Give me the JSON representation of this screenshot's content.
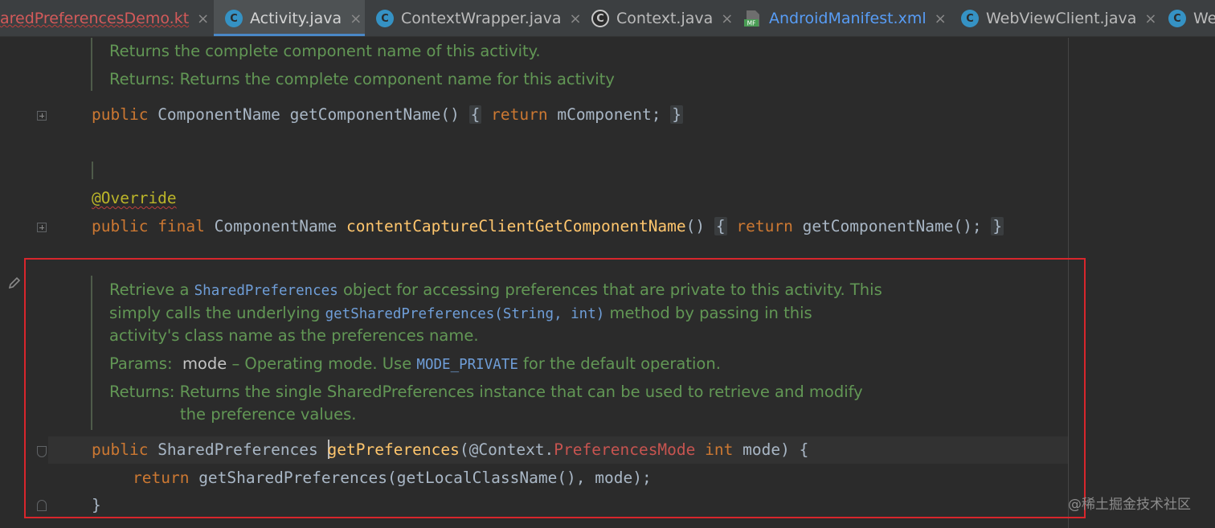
{
  "tabs": [
    {
      "label": "aredPreferencesDemo.kt",
      "icon": "kotlin-file-icon",
      "active": false
    },
    {
      "label": "Activity.java",
      "icon": "class-icon",
      "active": true
    },
    {
      "label": "ContextWrapper.java",
      "icon": "class-icon",
      "active": false
    },
    {
      "label": "Context.java",
      "icon": "abstract-class-icon",
      "active": false
    },
    {
      "label": "AndroidManifest.xml",
      "icon": "manifest-icon",
      "active": false
    },
    {
      "label": "WebViewClient.java",
      "icon": "class-icon",
      "active": false
    },
    {
      "label": "We",
      "icon": "class-icon",
      "active": false
    }
  ],
  "tab_close_glyph": "×",
  "class_icon_letter": "C",
  "manifest_icon_text": "MF",
  "editor": {
    "doc1": {
      "line1": "Returns the complete component name of this activity.",
      "line2": "Returns: Returns the complete component name for this activity"
    },
    "code1": {
      "kw": "public",
      "type": " ComponentName ",
      "fn": "getComponentName()",
      "open": "{",
      "ret": "return",
      "body": " mComponent;",
      "close": "}"
    },
    "annotation": "@Override",
    "code2": {
      "kw1": "public",
      "kw2": "final",
      "type": " ComponentName ",
      "fn": "contentCaptureClientGetComponentName",
      "paren": "()",
      "open": "{",
      "ret": "return",
      "body": " getComponentName();",
      "close": "}"
    },
    "doc2": {
      "l1_a": "Retrieve a ",
      "l1_b": "SharedPreferences",
      "l1_c": " object for accessing preferences that are private to this activity. This",
      "l2_a": "simply calls the underlying ",
      "l2_b": "getSharedPreferences(String, int)",
      "l2_c": " method by passing in this",
      "l3": "activity's class name as the preferences name.",
      "params_label": "Params:",
      "params_name": "mode",
      "params_a": " – Operating mode. Use ",
      "params_code": "MODE_PRIVATE",
      "params_b": " for the default operation.",
      "returns_label": "Returns:",
      "returns_l1": "Returns the single SharedPreferences instance that can be used to retrieve and modify",
      "returns_l2": "the preference values."
    },
    "code3": {
      "kw": "public",
      "type": " SharedPreferences ",
      "fn": "getPreferences",
      "a": "(@Context.",
      "red": "PreferencesMode",
      "int": "int",
      "b": " mode) {"
    },
    "code4": {
      "ret": "return",
      "body": " getSharedPreferences(getLocalClassName(), mode);"
    },
    "code5": "}"
  },
  "watermark": "@稀土掘金技术社区",
  "colors": {
    "keyword": "#cc7832",
    "method": "#ffc66d",
    "doc": "#629755",
    "annotation": "#bbb529",
    "highlight_box": "#d8262c",
    "active_tab_underline": "#4a88c7"
  }
}
